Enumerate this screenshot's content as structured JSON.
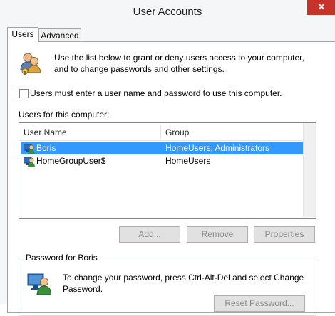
{
  "window": {
    "title": "User Accounts",
    "close_glyph": "✕"
  },
  "tabs": [
    {
      "label": "Users",
      "active": true
    },
    {
      "label": "Advanced",
      "active": false
    }
  ],
  "intro": {
    "icon": "users-icon",
    "text_line1": "Use the list below to grant or deny users access to your computer,",
    "text_line2": "and to change passwords and other settings."
  },
  "require_login": {
    "label": "Users must enter a user name and password to use this computer.",
    "checked": false
  },
  "users_list": {
    "caption": "Users for this computer:",
    "columns": [
      "User Name",
      "Group"
    ],
    "rows": [
      {
        "name": "Boris",
        "group": "HomeUsers; Administrators",
        "selected": true,
        "icon": "user-icon"
      },
      {
        "name": "HomeGroupUser$",
        "group": "HomeUsers",
        "selected": false,
        "icon": "user-icon"
      }
    ]
  },
  "actions": {
    "add": "Add...",
    "remove": "Remove",
    "properties": "Properties"
  },
  "password_group": {
    "title": "Password for Boris",
    "icon": "user-password-icon",
    "text_line1": "To change your password, press Ctrl-Alt-Del and select Change",
    "text_line2": "Password.",
    "reset_button": "Reset Password..."
  },
  "colors": {
    "selection": "#3399ff",
    "close_button": "#c7322a",
    "checkbox_border": "#3399d6"
  }
}
